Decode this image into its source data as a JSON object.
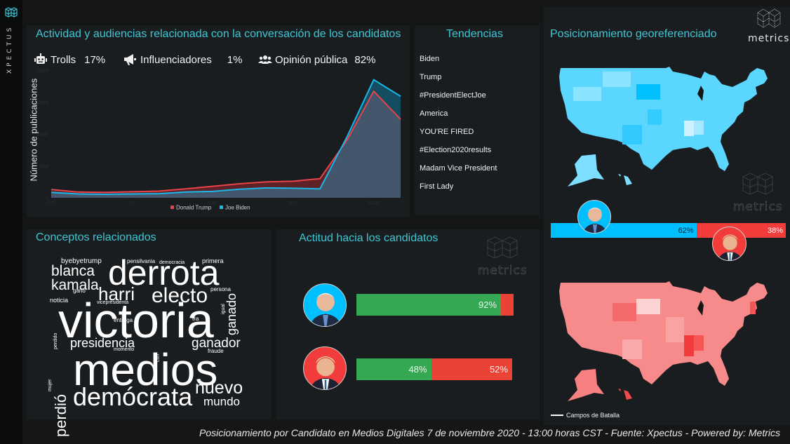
{
  "brand": {
    "name": "XPECTUS",
    "logo_icon": "cube-grid-icon"
  },
  "activity": {
    "title": "Actividad y audiencias relacionada con la conversación de los candidatos",
    "stats": [
      {
        "icon": "robot-icon",
        "label": "Trolls",
        "value": "17%"
      },
      {
        "icon": "megaphone-icon",
        "label": "Influenciadores",
        "value": "1%"
      },
      {
        "icon": "users-icon",
        "label": "Opinión pública",
        "value": "82%"
      }
    ]
  },
  "chart_data": {
    "type": "area",
    "title": "",
    "xlabel": "",
    "ylabel": "Número de publicaciones",
    "x": [
      0,
      1,
      2,
      3,
      4,
      5,
      6,
      7,
      8,
      9,
      10,
      11,
      12,
      13
    ],
    "x_ticks": [
      0,
      3,
      6,
      9,
      12
    ],
    "x_tick_labels": [
      "0:00",
      "3:00",
      "6:00",
      "9:00",
      "12:00"
    ],
    "y_ticks": [
      0,
      5000,
      10000,
      15000,
      20000
    ],
    "y_tick_labels": [
      "0",
      "5000",
      "10000",
      "15000",
      "20000"
    ],
    "ylim": [
      0,
      20000
    ],
    "xlim": [
      0,
      13
    ],
    "grid": false,
    "legend_position": "bottom",
    "series": [
      {
        "name": "Donald Trump",
        "color": "#e8434a",
        "values": [
          1300,
          900,
          850,
          950,
          1050,
          1400,
          1800,
          2200,
          2500,
          2600,
          3000,
          9000,
          16700,
          12300
        ]
      },
      {
        "name": "Joe Biden",
        "color": "#1ab8e8",
        "values": [
          850,
          600,
          550,
          600,
          650,
          900,
          1000,
          1350,
          1550,
          1500,
          1400,
          9500,
          18500,
          15900
        ]
      }
    ]
  },
  "trends": {
    "title": "Tendencias",
    "items": [
      "Biden",
      "Trump",
      "#PresidentElectJoe",
      "America",
      "YOU'RE FIRED",
      "#Election2020results",
      "Madam Vice President",
      "First Lady"
    ]
  },
  "geo": {
    "title": "Posicionamiento georeferenciado",
    "brand_word": "metrics",
    "biden": {
      "name": "Joe Biden",
      "share_pct": 62,
      "label": "62%",
      "color": "#00bfff"
    },
    "trump": {
      "name": "Donald Trump",
      "share_pct": 38,
      "label": "38%",
      "color": "#f23c3c"
    },
    "legend_label": "Campos de Batalla"
  },
  "concepts": {
    "title": "Conceptos relacionados",
    "words": [
      "victoria",
      "medios",
      "derrota",
      "demócrata",
      "electo",
      "blanca",
      "kamala",
      "harri",
      "presidencia",
      "ganador",
      "nuevo",
      "mundo",
      "perdió",
      "ganado",
      "byebyetrump",
      "pensilvania",
      "democracia",
      "primera",
      "persona",
      "noticia",
      "ganó",
      "vicepresidenta",
      "igual",
      "entrega",
      "tra",
      "perdido",
      "cnn",
      "momento",
      "fraude",
      "mujer"
    ]
  },
  "attitude": {
    "title": "Actitud hacia los candidatos",
    "brand_word": "metrics",
    "positive_color": "#34a853",
    "negative_color": "#ea4335",
    "rows": [
      {
        "candidate": "Joe Biden",
        "positive_pct": 92,
        "negative_pct": 8,
        "positive_label": "92%",
        "negative_label": ""
      },
      {
        "candidate": "Donald Trump",
        "positive_pct": 48,
        "negative_pct": 52,
        "positive_label": "48%",
        "negative_label": "52%"
      }
    ]
  },
  "footer": "Posicionamiento por Candidato en Medios Digitales 7 de noviembre 2020 - 13:00 horas CST - Fuente: Xpectus - Powered by: Metrics"
}
